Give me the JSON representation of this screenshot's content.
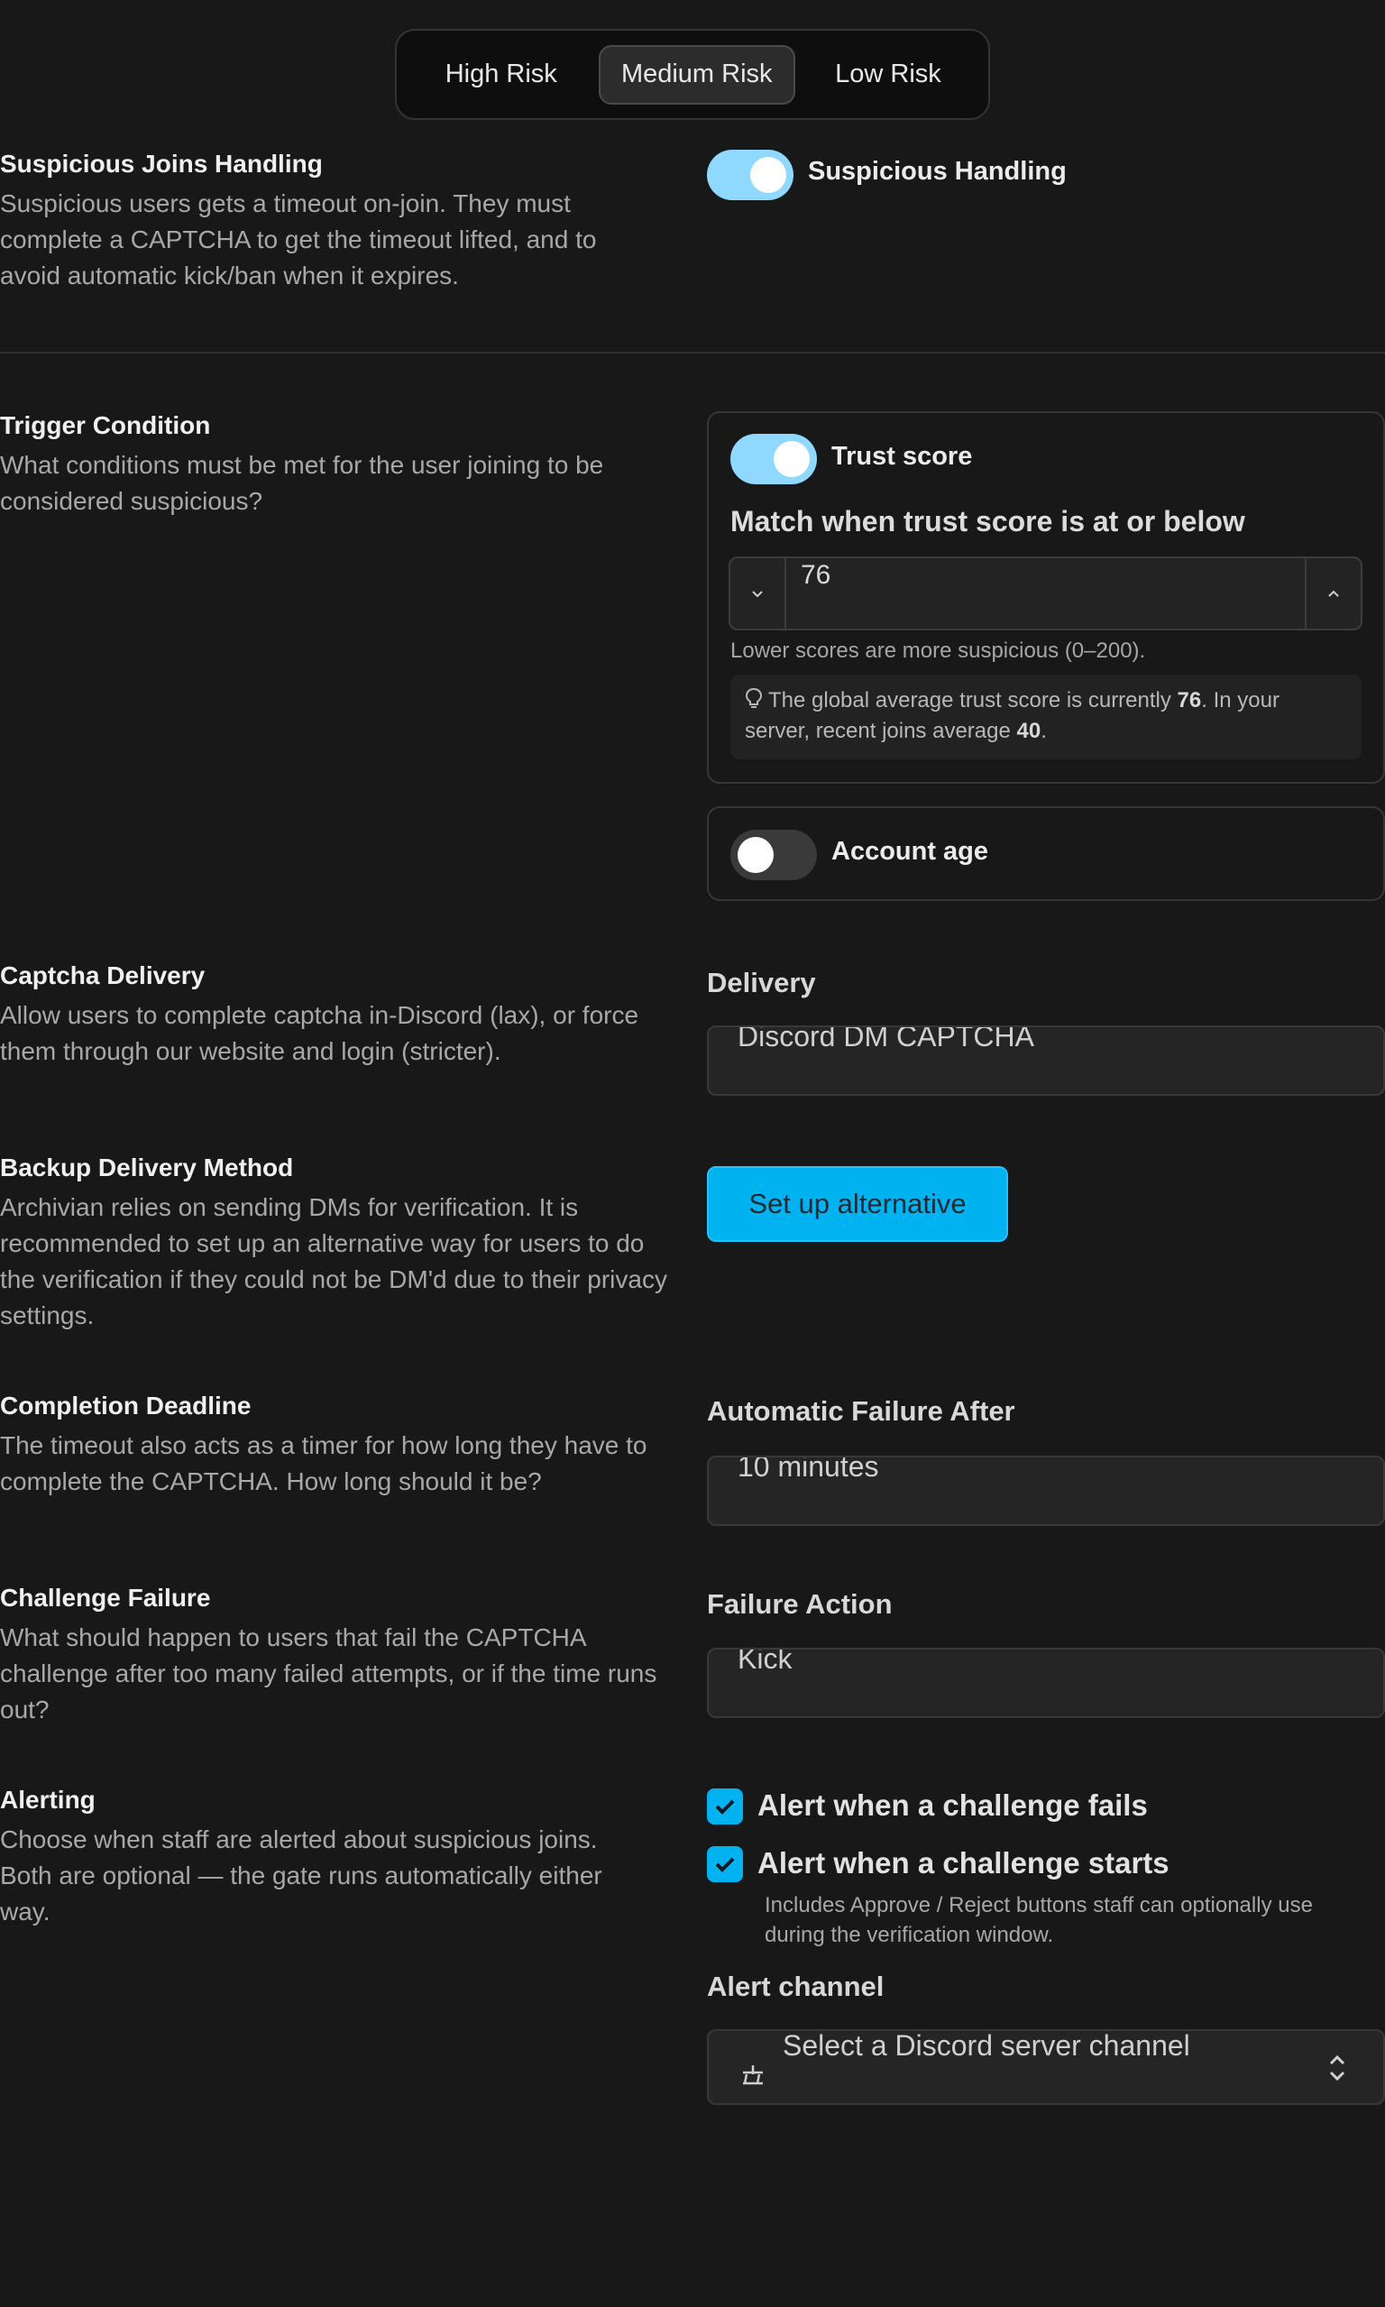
{
  "risk_tabs": [
    {
      "label": "High Risk",
      "active": false
    },
    {
      "label": "Medium Risk",
      "active": true
    },
    {
      "label": "Low Risk",
      "active": false
    }
  ],
  "suspicious": {
    "title": "Suspicious Joins Handling",
    "description": "Suspicious users gets a timeout on-join. They must complete a CAPTCHA to get the timeout lifted, and to avoid automatic kick/ban when it expires.",
    "toggle_label": "Suspicious Handling",
    "toggle_on": true
  },
  "trigger": {
    "title": "Trigger Condition",
    "description": "What conditions must be met for the user joining to be considered suspicious?",
    "trust_toggle_label": "Trust score",
    "trust_toggle_on": true,
    "heading": "Match when trust score is at or below",
    "value": "76",
    "hint": "Lower scores are more suspicious (0–200).",
    "info_prefix": "The global average trust score is currently ",
    "info_global": "76",
    "info_mid": ". In your server, recent joins average ",
    "info_recent": "40",
    "info_suffix": ".",
    "age_toggle_label": "Account age",
    "age_toggle_on": false
  },
  "delivery": {
    "title": "Captcha Delivery",
    "description": "Allow users to complete captcha in-Discord (lax), or force them through our website and login (stricter).",
    "heading": "Delivery",
    "value": "Discord DM CAPTCHA"
  },
  "backup": {
    "title": "Backup Delivery Method",
    "description": "Archivian relies on sending DMs for verification. It is recommended to set up an alternative way for users to do the verification if they could not be DM'd due to their privacy settings.",
    "button": "Set up alternative"
  },
  "deadline": {
    "title": "Completion Deadline",
    "description": "The timeout also acts as a timer for how long they have to complete the CAPTCHA. How long should it be?",
    "heading": "Automatic Failure After",
    "value": "10 minutes"
  },
  "failure": {
    "title": "Challenge Failure",
    "description": "What should happen to users that fail the CAPTCHA challenge after too many failed attempts, or if the time runs out?",
    "heading": "Failure Action",
    "value": "Kick"
  },
  "alerting": {
    "title": "Alerting",
    "description": "Choose when staff are alerted about suspicious joins. Both are optional — the gate runs automatically either way.",
    "check_fails": "Alert when a challenge fails",
    "check_starts": "Alert when a challenge starts",
    "check_starts_hint": "Includes Approve / Reject buttons staff can optionally use during the verification window.",
    "channel_heading": "Alert channel",
    "channel_placeholder": "Select a Discord server channel"
  },
  "colors": {
    "accent": "#00b3f0",
    "toggle_on": "#8fd8ff",
    "background": "#181818"
  },
  "icons": {
    "info": "lightbulb-icon",
    "stepper_dec": "chevron-down-icon",
    "stepper_inc": "chevron-up-icon",
    "check": "check-icon",
    "channel": "channel-hash-icon",
    "select": "chevron-updown-icon"
  }
}
